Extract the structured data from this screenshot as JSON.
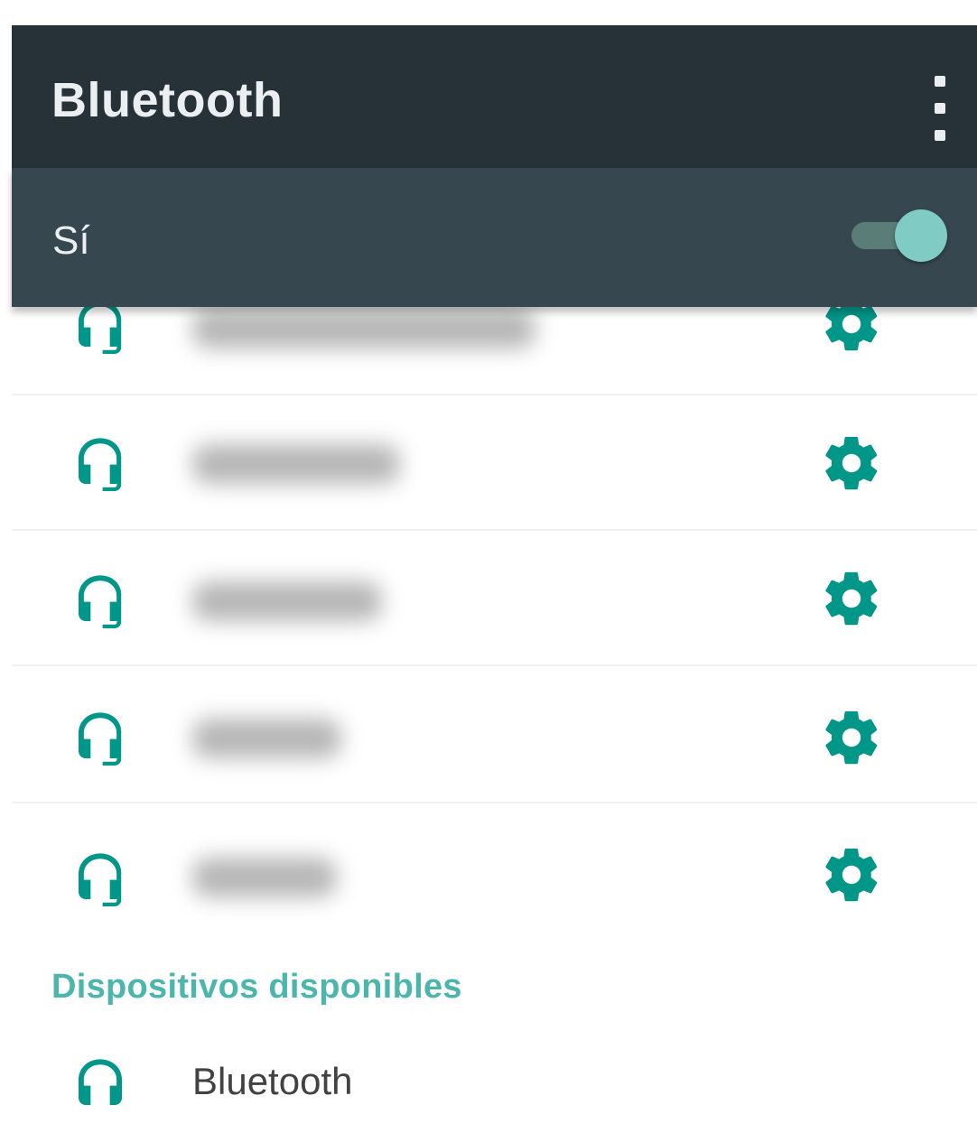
{
  "appbar": {
    "title": "Bluetooth"
  },
  "switchbar": {
    "label": "Sí",
    "enabled": true
  },
  "paired_devices": [
    {
      "name": "",
      "icon": "headphones-icon"
    },
    {
      "name": "",
      "icon": "headphones-icon"
    },
    {
      "name": "",
      "icon": "headphones-icon"
    },
    {
      "name": "",
      "icon": "headphones-icon"
    },
    {
      "name": "",
      "icon": "headphones-icon"
    }
  ],
  "available_section": {
    "header": "Dispositivos disponibles",
    "devices": [
      {
        "name": "Bluetooth",
        "icon": "headphones-icon"
      }
    ]
  },
  "colors": {
    "appbar": "#263238",
    "switchbar": "#37474f",
    "accent": "#009688",
    "accent_light": "#80cbc4",
    "section_header": "#4db6ac"
  }
}
